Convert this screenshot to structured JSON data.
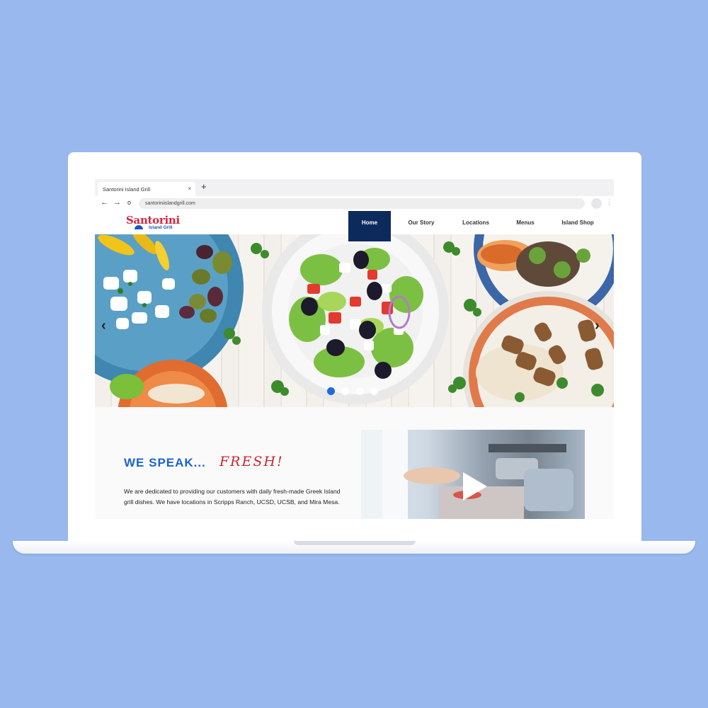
{
  "browser": {
    "tab_title": "Santorini Island Grill",
    "tab_close": "×",
    "new_tab": "+",
    "back": "←",
    "forward": "→",
    "reload": "o",
    "url": "santoriniislandgrill.com"
  },
  "site": {
    "logo_main": "Santorini",
    "logo_sub": "Island Grill",
    "nav": [
      {
        "label": "Home",
        "active": true
      },
      {
        "label": "Our Story"
      },
      {
        "label": "Locations"
      },
      {
        "label": "Menus"
      },
      {
        "label": "Island Shop"
      }
    ]
  },
  "hero": {
    "prev_arrow": "‹",
    "next_arrow": "›",
    "slide_count": 4,
    "active_slide": 1
  },
  "content": {
    "headline": "WE SPEAK...",
    "headline_accent": "FRESH!",
    "body": "We are dedicated to providing our customers with daily fresh-made Greek Island grill dishes. We have locations in Scripps Ranch, UCSD, UCSB, and Mira Mesa."
  },
  "colors": {
    "background": "#98b8ee",
    "nav_active": "#0d2a5c",
    "headline": "#1b63d1",
    "accent_red": "#c8252f",
    "dot_active": "#1d6ae5"
  },
  "icons": [
    "back-arrow-icon",
    "forward-arrow-icon",
    "reload-icon",
    "profile-icon",
    "kebab-menu-icon",
    "play-icon",
    "chevron-left-icon",
    "chevron-right-icon"
  ]
}
